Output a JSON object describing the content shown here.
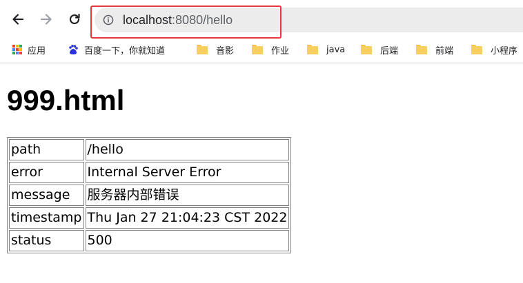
{
  "browser": {
    "url_host": "localhost",
    "url_rest": ":8080/hello",
    "accent_color": "#f7c21b",
    "highlight_color": "#e53935"
  },
  "bookmarks": [
    {
      "label": "应用",
      "icon": "apps-icon"
    },
    {
      "label": "百度一下，你就知道",
      "icon": "baidu-icon"
    },
    {
      "label": "音影",
      "icon": "folder-icon"
    },
    {
      "label": "作业",
      "icon": "folder-icon"
    },
    {
      "label": "java",
      "icon": "folder-icon"
    },
    {
      "label": "后端",
      "icon": "folder-icon"
    },
    {
      "label": "前端",
      "icon": "folder-icon"
    },
    {
      "label": "小程序",
      "icon": "folder-icon"
    }
  ],
  "page": {
    "heading": "999.html",
    "rows": [
      {
        "key": "path",
        "value": "/hello"
      },
      {
        "key": "error",
        "value": "Internal Server Error"
      },
      {
        "key": "message",
        "value": "服务器内部错误"
      },
      {
        "key": "timestamp",
        "value": "Thu Jan 27 21:04:23 CST 2022"
      },
      {
        "key": "status",
        "value": "500"
      }
    ]
  }
}
